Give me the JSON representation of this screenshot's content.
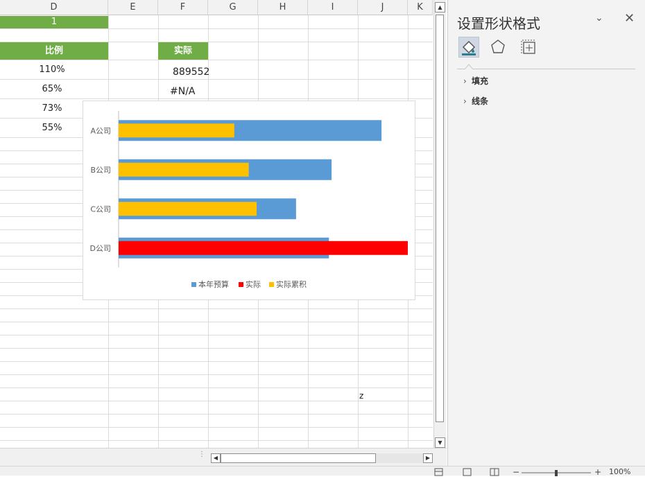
{
  "columns": [
    "D",
    "E",
    "F",
    "G",
    "H",
    "I",
    "J",
    "K"
  ],
  "cells": {
    "d_row1": "1",
    "d_header": "比例",
    "d_values": [
      "110%",
      "65%",
      "73%",
      "55%"
    ],
    "f_header": "实际",
    "f_row1": "889552",
    "f_row2": "#N/A",
    "j_text": "z"
  },
  "colors": {
    "header_green": "#70ad47",
    "budget": "#5b9bd5",
    "actual": "#ff0000",
    "cumulative": "#ffc000"
  },
  "chart_data": {
    "type": "bar",
    "orientation": "horizontal",
    "categories": [
      "A公司",
      "B公司",
      "C公司",
      "D公司"
    ],
    "series": [
      {
        "name": "本年预算",
        "values": [
          1.0,
          0.81,
          0.675,
          0.8
        ]
      },
      {
        "name": "实际",
        "values": [
          null,
          null,
          null,
          1.1
        ]
      },
      {
        "name": "实际累积",
        "values": [
          0.44,
          0.495,
          0.525,
          null
        ]
      }
    ],
    "xlim": [
      0,
      1.1
    ],
    "legend": "bottom",
    "grid": false
  },
  "pane": {
    "title": "设置形状格式",
    "sections": [
      "填充",
      "线条"
    ],
    "tabs": [
      "fill-line-icon",
      "effects-icon",
      "size-properties-icon"
    ]
  },
  "status": {
    "zoom": "100%"
  }
}
